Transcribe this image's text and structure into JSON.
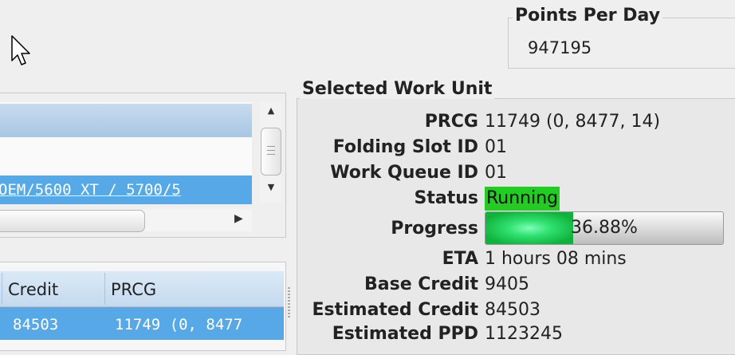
{
  "points_per_day": {
    "title": "Points Per Day",
    "value": "947195"
  },
  "slots": {
    "selected_row_text": "OEM/5600 XT / 5700/5"
  },
  "queue": {
    "columns": [
      "Credit",
      "PRCG"
    ],
    "rows": [
      {
        "credit": "84503",
        "prcg": "11749 (0, 8477"
      }
    ]
  },
  "selected_work_unit": {
    "title": "Selected Work Unit",
    "fields": {
      "prcg": {
        "label": "PRCG",
        "value": "11749 (0, 8477, 14)"
      },
      "folding_slot_id": {
        "label": "Folding Slot ID",
        "value": "01"
      },
      "work_queue_id": {
        "label": "Work Queue ID",
        "value": "01"
      },
      "status": {
        "label": "Status",
        "value": "Running",
        "color": "#22cc22"
      },
      "progress": {
        "label": "Progress",
        "value": "36.88%",
        "fraction": 0.3688
      },
      "eta": {
        "label": "ETA",
        "value": "1 hours 08 mins"
      },
      "base_credit": {
        "label": "Base Credit",
        "value": "9405"
      },
      "estimated_credit": {
        "label": "Estimated Credit",
        "value": "84503"
      },
      "estimated_ppd": {
        "label": "Estimated PPD",
        "value": "1123245"
      }
    }
  },
  "icons": {
    "cursor": "arrow-cursor-icon",
    "scroll_up": "triangle-up-icon",
    "scroll_down": "triangle-down-icon",
    "scroll_right": "triangle-right-icon"
  },
  "colors": {
    "selection": "#56a9e6",
    "status_running": "#22cc22",
    "progress_fill": "#2fe070"
  }
}
